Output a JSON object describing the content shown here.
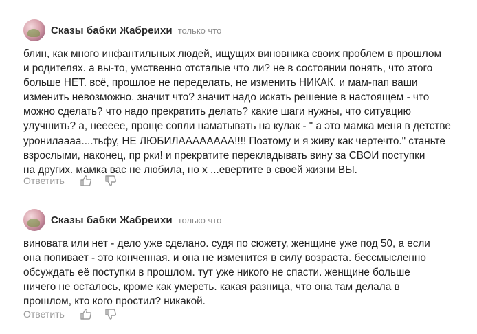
{
  "comments": [
    {
      "author": "Сказы бабки Жабреихи",
      "time": "только что",
      "lines": [
        "блин, как много инфантильных людей, ищущих виновника своих проблем в прошлом",
        "и родителях. а вы-то, умственно отсталые что ли? не в состоянии понять, что этого",
        "больше НЕТ. всё, прошлое не переделать, не изменить НИКАК. и мам-пап ваши",
        "изменить невозможно. значит что? значит надо искать решение в настоящем - что",
        "можно сделать? что надо прекратить делать? какие шаги нужны, что ситуацию",
        "улучшить? а, нееееe, проще сопли наматывать на кулак - \" а это мамка меня в детстве",
        "уронилаааа....тьфу, НЕ ЛЮБИЛАААААААА!!!! Поэтому и я живу как чертечто.\" станьте",
        "взрослыми, наконец, пр     рки! и прекратите перекладывать вину за СВОИ поступки",
        "на других. мамка вас не любила, но х   ...евертите в своей жизни ВЫ."
      ],
      "reply_label": "Ответить",
      "like_icon": "thumbs-up-icon",
      "dislike_icon": "thumbs-down-icon"
    },
    {
      "author": "Сказы бабки Жабреихи",
      "time": "только что",
      "lines": [
        "виновата или нет - дело уже сделано. судя по сюжету, женщине уже под 50, а если",
        "она попивает - это конченная. и она не изменится в силу возраста. бессмысленно",
        "обсуждать её поступки в прошлом. тут уже никого не спасти. женщине больше",
        "ничего не осталось, кроме как умереть. какая разница, что она там делала в",
        "прошлом, кто кого простил? никакой."
      ],
      "reply_label": "Ответить",
      "like_icon": "thumbs-up-icon",
      "dislike_icon": "thumbs-down-icon"
    }
  ]
}
